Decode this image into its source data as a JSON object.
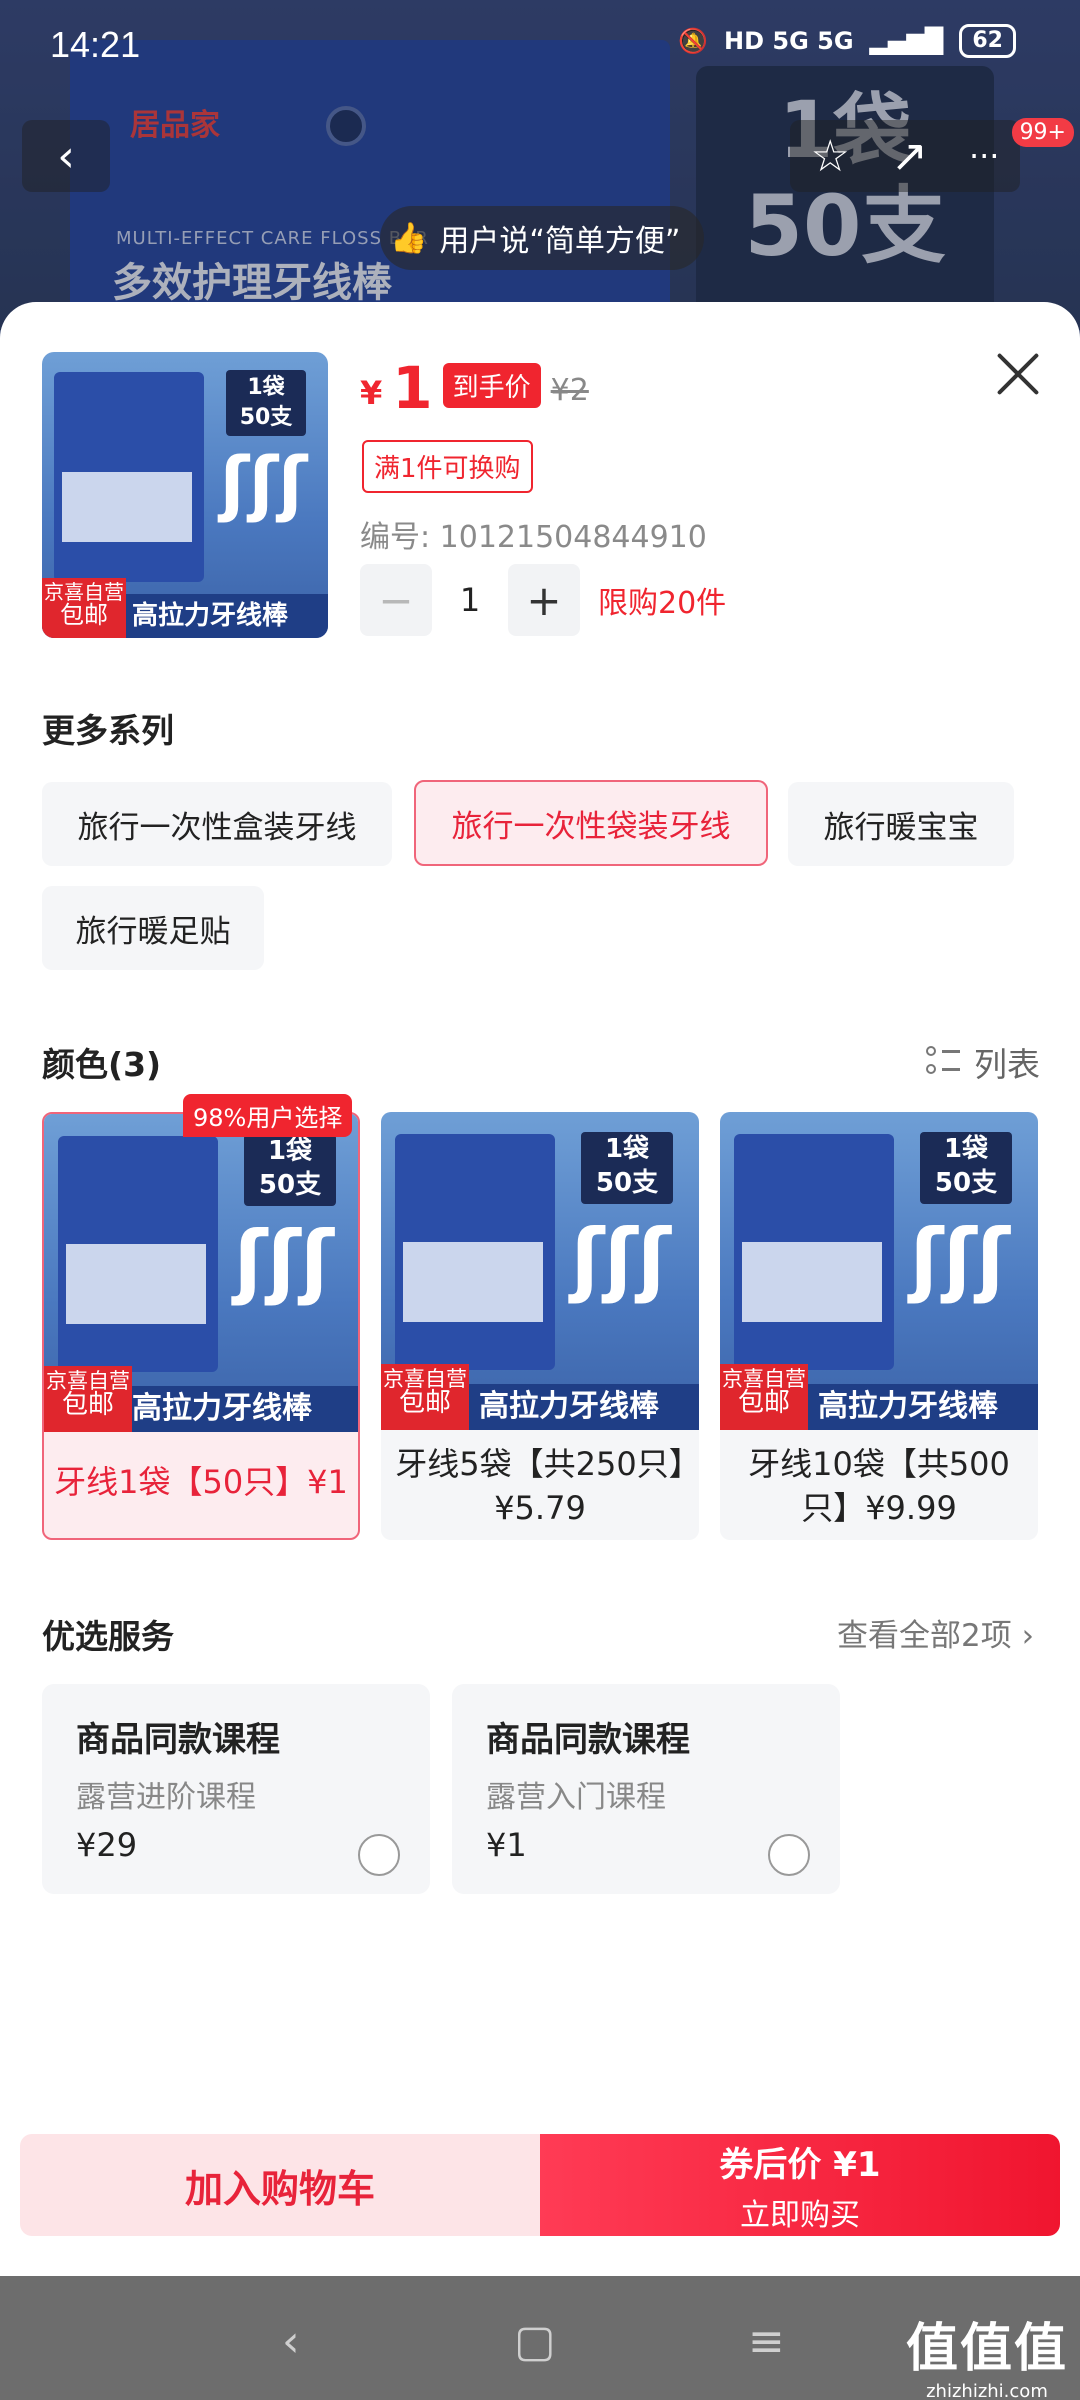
{
  "status_bar": {
    "time": "14:21",
    "network": "HD 5G 5G",
    "battery": "62"
  },
  "top_nav": {
    "back": "‹",
    "star": "☆",
    "share": "↗",
    "more": "···",
    "badge": "99+"
  },
  "background_product": {
    "brand": "居品家",
    "en_title": "MULTI-EFFECT CARE FLOSS BAR",
    "cn_title": "多效护理牙线棒",
    "bag_line1": "1袋",
    "bag_line2": "50支"
  },
  "toast": {
    "text": "用户说“简单方便”"
  },
  "product": {
    "image": {
      "bag_line1": "1袋",
      "bag_line2": "50支",
      "jd_line1": "京喜自营",
      "jd_line2": "包邮",
      "banner": "高拉力牙线棒"
    },
    "currency": "¥",
    "price": "1",
    "price_tag": "到手价",
    "original_price": "¥2",
    "promo": "满1件可换购",
    "sku": "编号: 10121504844910",
    "quantity": "1",
    "minus": "−",
    "plus": "+",
    "limit": "限购20件"
  },
  "series": {
    "title": "更多系列",
    "options": [
      "旅行一次性盒装牙线",
      "旅行一次性袋装牙线",
      "旅行暖宝宝",
      "旅行暖足贴"
    ],
    "selected_index": 1
  },
  "colors": {
    "title": "颜色(3)",
    "list_toggle": "列表",
    "badge": "98%用户选择",
    "options": [
      {
        "label": "牙线1袋【50只】¥1"
      },
      {
        "label": "牙线5袋【共250只】¥5.79"
      },
      {
        "label": "牙线10袋【共500只】¥9.99"
      }
    ],
    "selected_index": 0
  },
  "services": {
    "title": "优选服务",
    "see_all": "查看全部2项 ›",
    "items": [
      {
        "title": "商品同款课程",
        "subtitle": "露营进阶课程",
        "price": "¥29"
      },
      {
        "title": "商品同款课程",
        "subtitle": "露营入门课程",
        "price": "¥1"
      }
    ]
  },
  "actions": {
    "add_cart": "加入购物车",
    "buy_line1": "券后价 ¥1",
    "buy_line2": "立即购买"
  },
  "system_nav": {
    "back": "‹",
    "home": "▢",
    "menu": "≡"
  },
  "watermark": {
    "line1": "值值值",
    "line2": "zhizhizhi.com"
  },
  "colors_palette": {
    "accent": "#f0252f",
    "selected_bg": "#fdecef",
    "chip_bg": "#f5f6f8"
  }
}
